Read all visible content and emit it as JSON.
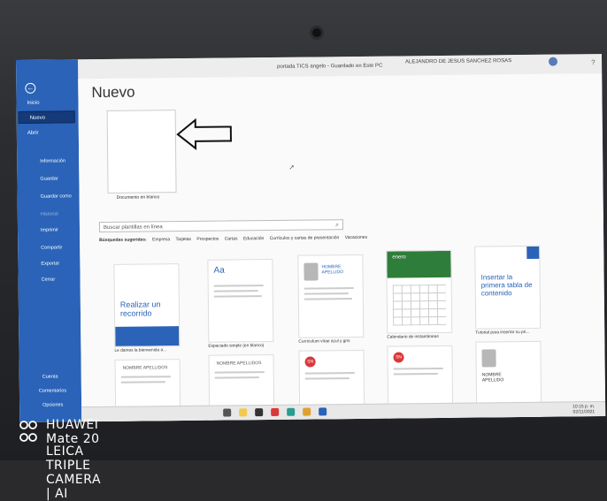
{
  "window": {
    "doc_title": "portada TICS angelo - Guardado en Este PC",
    "user_name": "ALEJANDRO DE JESUS SANCHEZ ROSAS",
    "controls": [
      "?",
      "—",
      "□",
      "✕"
    ]
  },
  "nav": {
    "back_glyph": "←",
    "items": [
      {
        "label": "Inicio"
      },
      {
        "label": "Nuevo"
      },
      {
        "label": "Abrir"
      }
    ],
    "sub_items": [
      "Información",
      "Guardar",
      "Guardar como",
      "Historial",
      "Imprimir",
      "Compartir",
      "Exportar",
      "Cerrar"
    ],
    "bottom_items": [
      "Cuenta",
      "Comentarios",
      "Opciones"
    ]
  },
  "main": {
    "heading": "Nuevo",
    "blank_label": "Documento en blanco",
    "search_placeholder": "Buscar plantillas en línea",
    "suggest_label": "Búsquedas sugeridas:",
    "suggestions": [
      "Empresa",
      "Tarjetas",
      "Prospectos",
      "Cartas",
      "Educación",
      "Currículos y cartas de presentación",
      "Vacaciones"
    ],
    "templates": [
      {
        "caption": "Le damos la bienvenida a...",
        "title": "Realizar un recorrido"
      },
      {
        "caption": "Espaciado simple (en blanco)",
        "title": "Aa"
      },
      {
        "caption": "Currículum vítae azul y gris",
        "title": "HOMBRE APELLIDO"
      },
      {
        "caption": "Calendario de instantáneas",
        "title": "enero"
      },
      {
        "caption": "Tutorial para insertar su pri...",
        "title": "Insertar la primera tabla de contenido"
      }
    ],
    "row2": [
      {
        "title": "NOMBRE APELLIDOS"
      },
      {
        "title": "NOMBRE APELLIDOS"
      },
      {
        "title": "SN"
      },
      {
        "title": "SN"
      },
      {
        "title": "NOMBRE APELLIDO"
      }
    ]
  },
  "taskbar": {
    "time": "10:15 p. m.",
    "date": "02/11/2021"
  },
  "watermark": {
    "line1": "HUAWEI Mate 20",
    "line2": "LEICA TRIPLE CAMERA | AI"
  },
  "colors": {
    "accent": "#2a63b8",
    "nav_selected": "#143a7a"
  }
}
